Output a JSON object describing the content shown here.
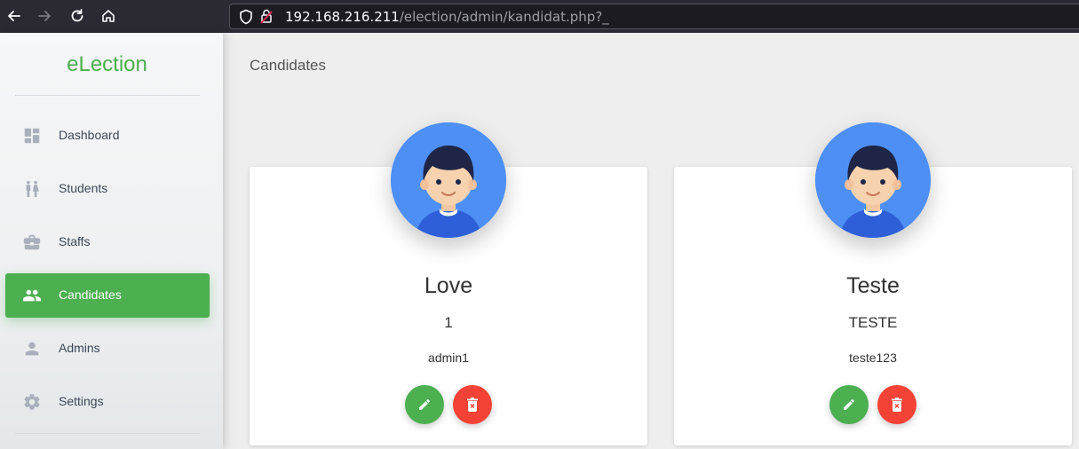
{
  "browser": {
    "url_host": "192.168.216.211",
    "url_path": "/election/admin/kandidat.php?_"
  },
  "sidebar": {
    "logo": "eLection",
    "items": [
      {
        "label": "Dashboard",
        "icon": "dashboard-icon"
      },
      {
        "label": "Students",
        "icon": "students-icon"
      },
      {
        "label": "Staffs",
        "icon": "briefcase-icon"
      },
      {
        "label": "Candidates",
        "icon": "people-icon",
        "active": true
      },
      {
        "label": "Admins",
        "icon": "person-icon"
      },
      {
        "label": "Settings",
        "icon": "gear-icon"
      }
    ]
  },
  "main": {
    "title": "Candidates",
    "candidates": [
      {
        "name": "Love",
        "number": "1",
        "username": "admin1"
      },
      {
        "name": "Teste",
        "number": "TESTE",
        "username": "teste123"
      }
    ]
  },
  "colors": {
    "accent": "#4caf50",
    "danger": "#f44336",
    "avatar_bg": "#4d8ff5"
  }
}
